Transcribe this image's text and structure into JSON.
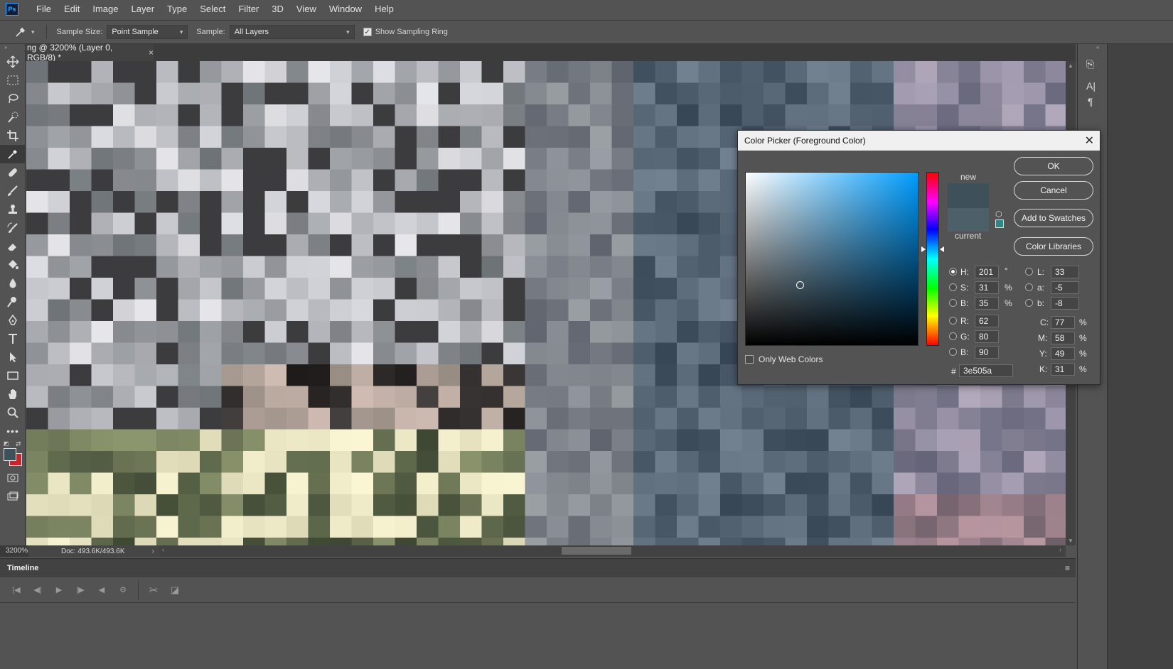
{
  "app": {
    "logo": "Ps"
  },
  "menu": [
    "File",
    "Edit",
    "Image",
    "Layer",
    "Type",
    "Select",
    "Filter",
    "3D",
    "View",
    "Window",
    "Help"
  ],
  "options": {
    "sample_size_label": "Sample Size:",
    "sample_size_value": "Point Sample",
    "sample_label": "Sample:",
    "sample_value": "All Layers",
    "show_ring_label": "Show Sampling Ring"
  },
  "document": {
    "tab_title": "ng @ 3200% (Layer 0, RGB/8) *",
    "close": "×",
    "zoom": "3200%",
    "doc_info": "Doc: 493.6K/493.6K"
  },
  "timeline": {
    "title": "Timeline"
  },
  "dialog": {
    "title": "Color Picker (Foreground Color)",
    "new_label": "new",
    "current_label": "current",
    "buttons": {
      "ok": "OK",
      "cancel": "Cancel",
      "add_swatches": "Add to Swatches",
      "libraries": "Color Libraries"
    },
    "only_web_colors": "Only Web Colors",
    "hsb": {
      "h_label": "H:",
      "h": "201",
      "h_unit": "°",
      "s_label": "S:",
      "s": "31",
      "s_unit": "%",
      "b_label": "B:",
      "b": "35",
      "b_unit": "%"
    },
    "rgb": {
      "r_label": "R:",
      "r": "62",
      "g_label": "G:",
      "g": "80",
      "b_label": "B:",
      "b": "90"
    },
    "lab": {
      "l_label": "L:",
      "l": "33",
      "a_label": "a:",
      "a": "-5",
      "b_label": "b:",
      "b": "-8"
    },
    "cmyk": {
      "c_label": "C:",
      "c": "77",
      "m_label": "M:",
      "m": "58",
      "y_label": "Y:",
      "y": "49",
      "k_label": "K:",
      "k": "31",
      "unit": "%"
    },
    "hex_label": "#",
    "hex": "3e505a"
  },
  "colors": {
    "new": "#3e505a",
    "current": "#4d5f69",
    "foreground": "#3e505a",
    "background": "#d0202a"
  }
}
